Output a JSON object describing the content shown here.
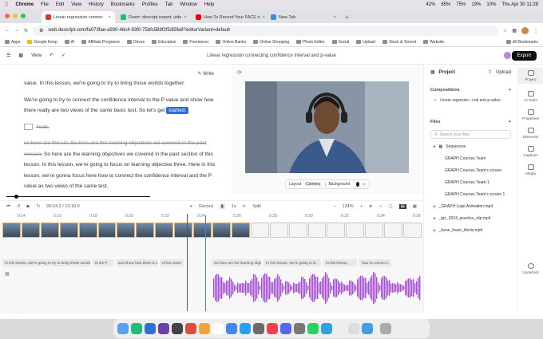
{
  "menubar": {
    "app": "Chrome",
    "items": [
      "File",
      "Edit",
      "View",
      "History",
      "Bookmarks",
      "Profiles",
      "Tab",
      "Window",
      "Help"
    ],
    "battery": "42%",
    "wifi": "85%",
    "vol": "75%",
    "bat2": "19%",
    "lang": "10%",
    "clock": "Thu Apr 30  11:28",
    "gemini": "Ask Gemini"
  },
  "tabs": [
    {
      "title": "Linear regression connec",
      "color": "#d33"
    },
    {
      "title": "Fiverr: descript expert, vide",
      "color": "#1dbf73"
    },
    {
      "title": "How To Record Your FACE o",
      "color": "#f00"
    },
    {
      "title": "New Tab",
      "color": "#4285f4"
    }
  ],
  "address": {
    "url": "web.descript.com/fa073fae-a930-48c4-93f0-75bfc589f2f5/85fa9?editorVariant=default"
  },
  "bookmarks": [
    "Apps",
    "Google Keep",
    "AI",
    "Affiliate Programe",
    "Drives",
    "Education",
    "Freelancer",
    "Online Banks",
    "Online Shopping",
    "Photo Editor",
    "Social",
    "Upload",
    "Stock & Torrent",
    "Website"
  ],
  "bookmarks_all": "All Bookmarks",
  "app": {
    "view": "View",
    "title": "Linear regression connecting confidence interval and p-value",
    "export": "Export",
    "write": "Write"
  },
  "transcript": {
    "p1": "value. In this lesson, we're going to try to bring those worlds together.",
    "p2a": "We're going to try to connect the confidence interval to the P value and show how there really are two views of the same basic test. So let's get",
    "p2b": "started.",
    "p3": "Yeah,",
    "p4a": "so here are the Lin. So here are the learning objectives we covered in the past version.",
    "p4b": "So here are the learning objectives we covered in the past section of this lesson. In this lesson, we're going to focus on learning objective three. Here in this lesson, we're gonna focus here how to connect the confidence interval and the P value as two views of the same test."
  },
  "layoutbar": {
    "layout": "Layout",
    "layout_val": "Camera",
    "background": "Background"
  },
  "transport": {
    "time": "00:24.2 / 13:10.0",
    "record": "Record",
    "speed": "1x",
    "split": "Split",
    "zoom": "124%"
  },
  "ruler": [
    "0:14",
    "0:16",
    "0:18",
    "0:20",
    "0:22",
    "0:24",
    "0:26",
    "0:28",
    "0:30",
    "0:32",
    "0:34",
    "0:36"
  ],
  "captions": [
    "In this lesson, we're going to try to bring those worlds t",
    "to the P",
    "and show how there is a",
    "of the same",
    "So here are the learning objectives we cc",
    "In this lesson, we're going to fo",
    "In this lesson,",
    "how to connect t"
  ],
  "sidebar": {
    "project": "Project",
    "upload": "Upload",
    "compositions": "Compositions",
    "comp_item": "Linear regressio...rval and p-value",
    "files": "Files",
    "search_placeholder": "Search your files",
    "items": [
      "Sequences",
      "GRAPH Courses Team",
      "GRAPH Courses Team's screen",
      "GRAPH Courses Team-1",
      "GRAPH Courses Team's screen 1",
      "_GRAPH Logo Animation.mp4",
      "_tgc_2024_practice_clip.mp4",
      "_bene_lower_thirds.mp4"
    ]
  },
  "rail": [
    "Project",
    "AI Tools",
    "Properties",
    "Elements",
    "Captions",
    "Media",
    "Underlord"
  ]
}
